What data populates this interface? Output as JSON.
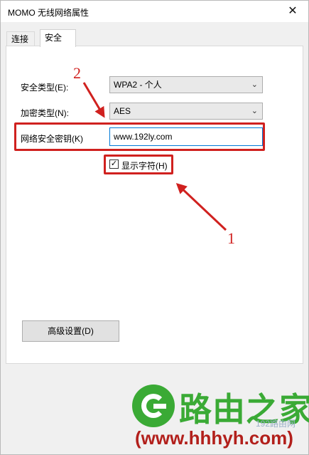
{
  "window": {
    "title": "MOMO 无线网络属性",
    "close_label": "✕"
  },
  "tabs": [
    {
      "label": "连接"
    },
    {
      "label": "安全"
    }
  ],
  "form": {
    "security_type_label": "安全类型(E):",
    "security_type_value": "WPA2 - 个人",
    "encryption_type_label": "加密类型(N):",
    "encryption_type_value": "AES",
    "network_key_label": "网络安全密钥(K)",
    "network_key_value": "www.192ly.com",
    "show_characters_label": "显示字符(H)",
    "show_characters_checked": true,
    "advanced_button_label": "高级设置(D)"
  },
  "annotations": {
    "label_1": "1",
    "label_2": "2",
    "color": "#d0211f"
  },
  "watermark": {
    "logo_text": "路由之家",
    "url_text": "(www.hhhyh.com)",
    "small_text": "192路由网",
    "brand_green": "#3aaa35",
    "brand_red": "#b21f1b"
  }
}
